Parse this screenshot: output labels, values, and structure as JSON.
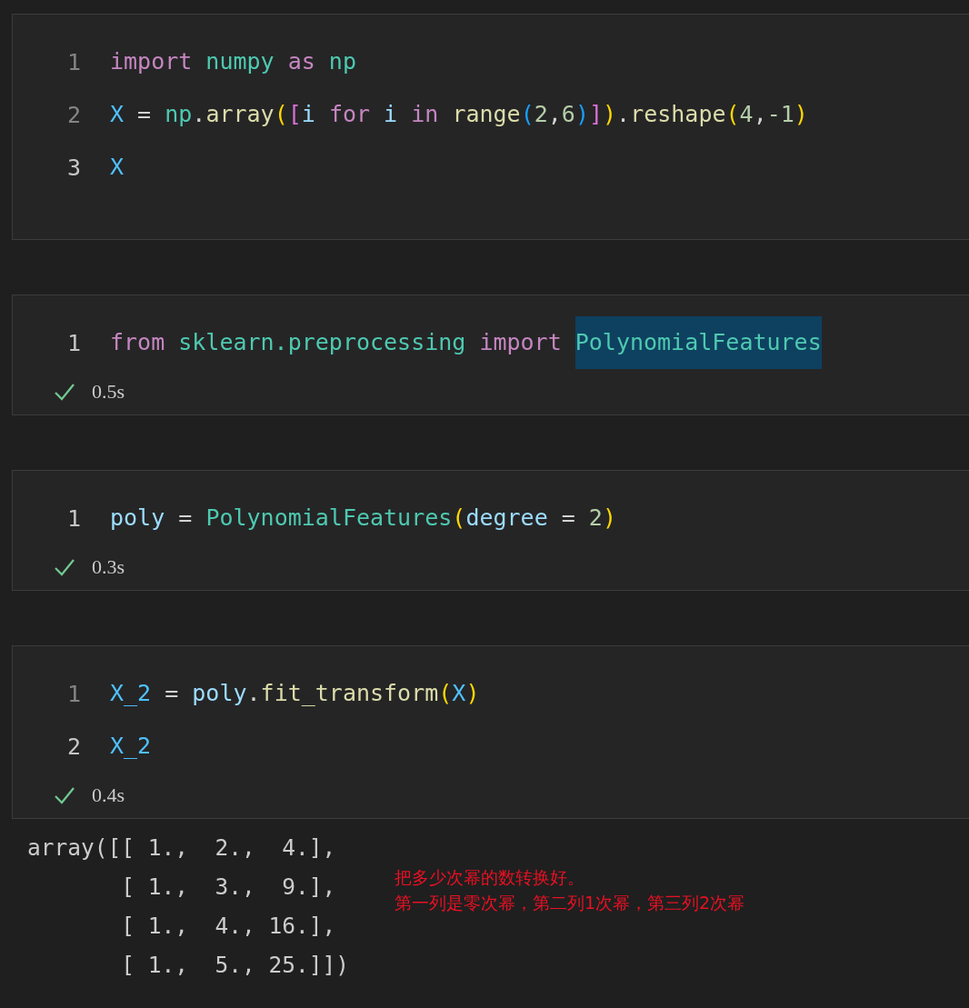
{
  "cells": [
    {
      "lines": [
        {
          "number": "1",
          "active": false,
          "tokens": [
            {
              "text": "import ",
              "kind": "keyword",
              "selected": false
            },
            {
              "text": "numpy ",
              "kind": "module",
              "selected": false
            },
            {
              "text": "as ",
              "kind": "keyword",
              "selected": false
            },
            {
              "text": "np",
              "kind": "module",
              "selected": false
            }
          ]
        },
        {
          "number": "2",
          "active": false,
          "tokens": [
            {
              "text": "X",
              "kind": "constant",
              "selected": false
            },
            {
              "text": " = ",
              "kind": "operator",
              "selected": false
            },
            {
              "text": "np",
              "kind": "module",
              "selected": false
            },
            {
              "text": ".",
              "kind": "operator",
              "selected": false
            },
            {
              "text": "array",
              "kind": "function",
              "selected": false
            },
            {
              "text": "(",
              "kind": "bracket1",
              "selected": false
            },
            {
              "text": "[",
              "kind": "bracket2",
              "selected": false
            },
            {
              "text": "i ",
              "kind": "variable",
              "selected": false
            },
            {
              "text": "for ",
              "kind": "keyword",
              "selected": false
            },
            {
              "text": "i ",
              "kind": "variable",
              "selected": false
            },
            {
              "text": "in ",
              "kind": "keyword",
              "selected": false
            },
            {
              "text": "range",
              "kind": "function",
              "selected": false
            },
            {
              "text": "(",
              "kind": "bracket3",
              "selected": false
            },
            {
              "text": "2",
              "kind": "number",
              "selected": false
            },
            {
              "text": ",",
              "kind": "operator",
              "selected": false
            },
            {
              "text": "6",
              "kind": "number",
              "selected": false
            },
            {
              "text": ")",
              "kind": "bracket3",
              "selected": false
            },
            {
              "text": "]",
              "kind": "bracket2",
              "selected": false
            },
            {
              "text": ")",
              "kind": "bracket1",
              "selected": false
            },
            {
              "text": ".",
              "kind": "operator",
              "selected": false
            },
            {
              "text": "reshape",
              "kind": "function",
              "selected": false
            },
            {
              "text": "(",
              "kind": "bracket1",
              "selected": false
            },
            {
              "text": "4",
              "kind": "number",
              "selected": false
            },
            {
              "text": ",",
              "kind": "operator",
              "selected": false
            },
            {
              "text": "-1",
              "kind": "number",
              "selected": false
            },
            {
              "text": ")",
              "kind": "bracket1",
              "selected": false
            }
          ]
        },
        {
          "number": "3",
          "active": true,
          "tokens": [
            {
              "text": "X",
              "kind": "constant",
              "selected": false
            }
          ]
        }
      ]
    },
    {
      "lines": [
        {
          "number": "1",
          "active": true,
          "tokens": [
            {
              "text": "from ",
              "kind": "keyword",
              "selected": false
            },
            {
              "text": "sklearn.preprocessing ",
              "kind": "module",
              "selected": false
            },
            {
              "text": "import ",
              "kind": "keyword",
              "selected": false
            },
            {
              "text": "PolynomialFeatures",
              "kind": "module",
              "selected": true
            }
          ]
        }
      ],
      "status": {
        "kind": "success",
        "time": "0.5s"
      }
    },
    {
      "lines": [
        {
          "number": "1",
          "active": true,
          "tokens": [
            {
              "text": "poly",
              "kind": "variable",
              "selected": false
            },
            {
              "text": " = ",
              "kind": "operator",
              "selected": false
            },
            {
              "text": "PolynomialFeatures",
              "kind": "module",
              "selected": false
            },
            {
              "text": "(",
              "kind": "bracket1",
              "selected": false
            },
            {
              "text": "degree",
              "kind": "variable",
              "selected": false
            },
            {
              "text": " = ",
              "kind": "operator",
              "selected": false
            },
            {
              "text": "2",
              "kind": "number",
              "selected": false
            },
            {
              "text": ")",
              "kind": "bracket1",
              "selected": false
            }
          ]
        }
      ],
      "status": {
        "kind": "success",
        "time": "0.3s"
      }
    },
    {
      "lines": [
        {
          "number": "1",
          "active": false,
          "tokens": [
            {
              "text": "X_2",
              "kind": "constant",
              "selected": false
            },
            {
              "text": " = ",
              "kind": "operator",
              "selected": false
            },
            {
              "text": "poly",
              "kind": "variable",
              "selected": false
            },
            {
              "text": ".",
              "kind": "operator",
              "selected": false
            },
            {
              "text": "fit_transform",
              "kind": "function",
              "selected": false
            },
            {
              "text": "(",
              "kind": "bracket1",
              "selected": false
            },
            {
              "text": "X",
              "kind": "constant",
              "selected": false
            },
            {
              "text": ")",
              "kind": "bracket1",
              "selected": false
            }
          ]
        },
        {
          "number": "2",
          "active": true,
          "tokens": [
            {
              "text": "X_2",
              "kind": "constant",
              "selected": false
            }
          ]
        }
      ],
      "status": {
        "kind": "success",
        "time": "0.4s"
      },
      "output": {
        "lines": [
          "array([[ 1.,  2.,  4.],",
          "       [ 1.,  3.,  9.],",
          "       [ 1.,  4., 16.],",
          "       [ 1.,  5., 25.]])"
        ],
        "annotation": [
          "把多少次幂的数转换好。",
          "第一列是零次幂，第二列1次幂，第三列2次幂"
        ]
      }
    }
  ]
}
